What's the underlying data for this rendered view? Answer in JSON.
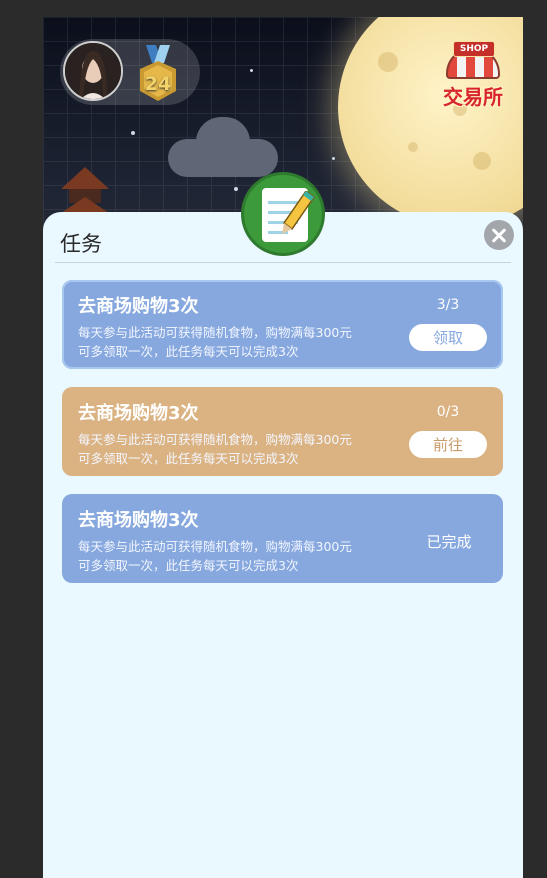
{
  "header": {
    "level": "24",
    "shop_sign": "SHOP",
    "shop_label": "交易所"
  },
  "panel": {
    "title": "任务"
  },
  "tasks": [
    {
      "name": "去商场购物3次",
      "desc_line1": "每天参与此活动可获得随机食物，购物满每300元",
      "desc_line2": "可多领取一次，此任务每天可以完成3次",
      "progress": "3/3",
      "action": "领取",
      "color": "#86a8de"
    },
    {
      "name": "去商场购物3次",
      "desc_line1": "每天参与此活动可获得随机食物，购物满每300元",
      "desc_line2": "可多领取一次，此任务每天可以完成3次",
      "progress": "0/3",
      "action": "前往",
      "color": "#dbb383"
    },
    {
      "name": "去商场购物3次",
      "desc_line1": "每天参与此活动可获得随机食物，购物满每300元",
      "desc_line2": "可多领取一次，此任务每天可以完成3次",
      "status": "已完成",
      "color": "#86a8de"
    }
  ],
  "colors": {
    "claim_text": "#86a8de",
    "go_text": "#c89b6a",
    "panel_bg": "#eaf8ff"
  }
}
